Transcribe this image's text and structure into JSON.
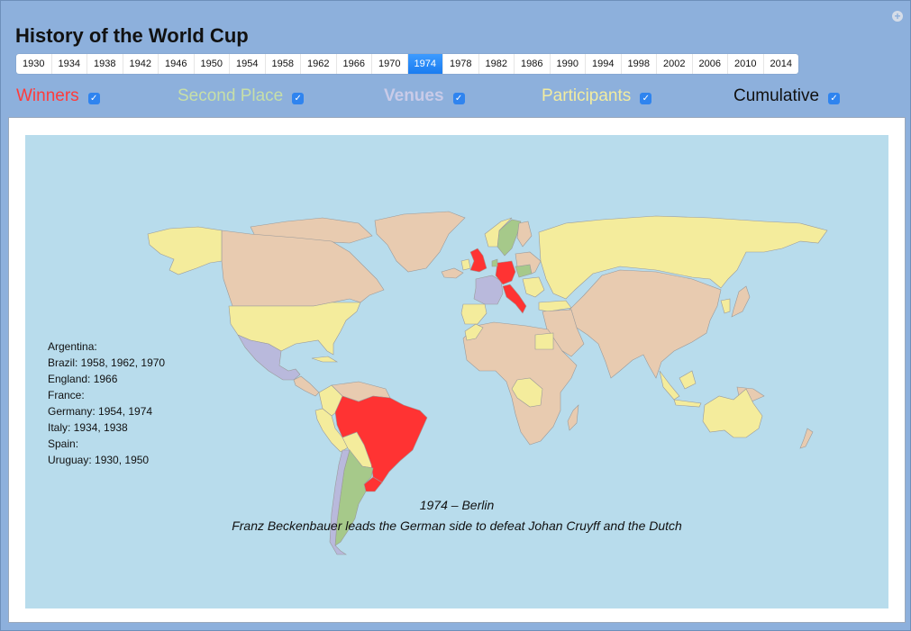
{
  "app": {
    "title": "History of the World Cup",
    "add_icon": "plus-circle-icon"
  },
  "years": [
    "1930",
    "1934",
    "1938",
    "1942",
    "1946",
    "1950",
    "1954",
    "1958",
    "1962",
    "1966",
    "1970",
    "1974",
    "1978",
    "1982",
    "1986",
    "1990",
    "1994",
    "1998",
    "2002",
    "2006",
    "2010",
    "2014"
  ],
  "selected_year": "1974",
  "toggles": [
    {
      "label": "Winners",
      "checked": true,
      "color": "#ff3b3b"
    },
    {
      "label": "Second Place",
      "checked": true,
      "color": "#c7dfa8"
    },
    {
      "label": "Venues",
      "checked": true,
      "color": "#c9cbe8"
    },
    {
      "label": "Participants",
      "checked": true,
      "color": "#f2eca0"
    },
    {
      "label": "Cumulative",
      "checked": true,
      "color": "#111111"
    }
  ],
  "map_colors": {
    "ocean": "#b8dcec",
    "other": "#e8cbb0",
    "winner": "#ff3333",
    "second": "#a6c98a",
    "venue": "#b9b9dc",
    "participant": "#f4ec9c",
    "border": "#9a9a9a"
  },
  "winners_summary": [
    "Argentina:",
    "Brazil: 1958, 1962, 1970",
    "England: 1966",
    "France:",
    "Germany: 1954, 1974",
    "Italy: 1934, 1938",
    "Spain:",
    "Uruguay: 1930, 1950"
  ],
  "caption": {
    "title": "1974 – Berlin",
    "description": "Franz Beckenbauer leads the German side to defeat Johan Cruyff and the Dutch"
  }
}
